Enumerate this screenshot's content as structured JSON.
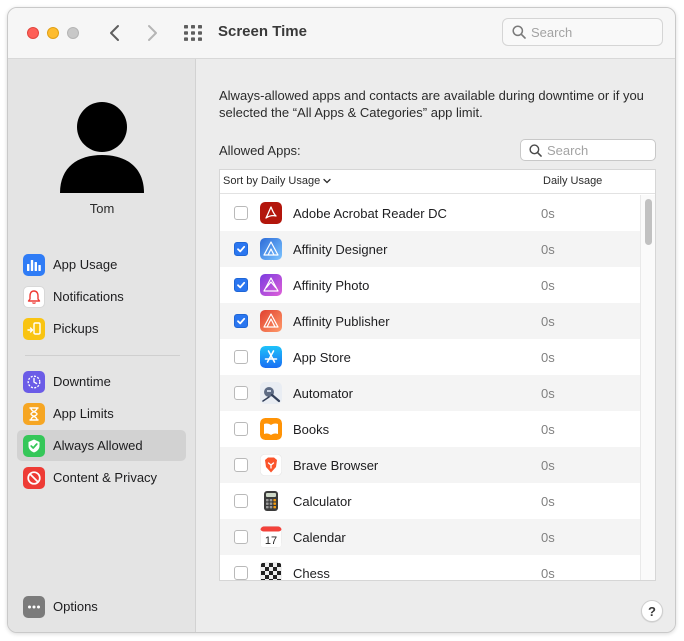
{
  "window": {
    "title": "Screen Time"
  },
  "toolbar": {
    "search_placeholder": "Search"
  },
  "user": {
    "name": "Tom"
  },
  "sidebar": {
    "group1": [
      {
        "name": "sidebar-item-app-usage",
        "label": "App Usage",
        "icon": "bar-chart-icon",
        "color": "#2f7cf6"
      },
      {
        "name": "sidebar-item-notifications",
        "label": "Notifications",
        "icon": "bell-icon",
        "color": "#ffffff"
      },
      {
        "name": "sidebar-item-pickups",
        "label": "Pickups",
        "icon": "phone-pickup-icon",
        "color": "#f9c412"
      }
    ],
    "group2": [
      {
        "name": "sidebar-item-downtime",
        "label": "Downtime",
        "icon": "moon-clock-icon",
        "color": "#6b5ce7"
      },
      {
        "name": "sidebar-item-app-limits",
        "label": "App Limits",
        "icon": "hourglass-icon",
        "color": "#f6a623"
      },
      {
        "name": "sidebar-item-always-allowed",
        "label": "Always Allowed",
        "icon": "checkmark-shield-icon",
        "color": "#35c759",
        "selected": true
      },
      {
        "name": "sidebar-item-content-privacy",
        "label": "Content & Privacy",
        "icon": "no-entry-icon",
        "color": "#ee3b35"
      }
    ],
    "options": {
      "label": "Options",
      "icon": "ellipsis-icon",
      "color": "#7b7b7b"
    }
  },
  "main": {
    "description": "Always-allowed apps and contacts are available during downtime or if you selected the “All Apps & Categories” app limit.",
    "allowed_label": "Allowed Apps:",
    "search_placeholder": "Search",
    "sort_label": "Sort by Daily Usage",
    "usage_header": "Daily Usage",
    "help_label": "?"
  },
  "apps": [
    {
      "name": "Adobe Acrobat Reader DC",
      "usage": "0s",
      "checked": false,
      "icon": "acrobat-icon"
    },
    {
      "name": "Affinity Designer",
      "usage": "0s",
      "checked": true,
      "icon": "affinity-designer-icon"
    },
    {
      "name": "Affinity Photo",
      "usage": "0s",
      "checked": true,
      "icon": "affinity-photo-icon"
    },
    {
      "name": "Affinity Publisher",
      "usage": "0s",
      "checked": true,
      "icon": "affinity-publisher-icon"
    },
    {
      "name": "App Store",
      "usage": "0s",
      "checked": false,
      "icon": "app-store-icon"
    },
    {
      "name": "Automator",
      "usage": "0s",
      "checked": false,
      "icon": "automator-icon"
    },
    {
      "name": "Books",
      "usage": "0s",
      "checked": false,
      "icon": "books-icon"
    },
    {
      "name": "Brave Browser",
      "usage": "0s",
      "checked": false,
      "icon": "brave-icon"
    },
    {
      "name": "Calculator",
      "usage": "0s",
      "checked": false,
      "icon": "calculator-icon"
    },
    {
      "name": "Calendar",
      "usage": "0s",
      "checked": false,
      "icon": "calendar-icon",
      "calendar_day": "17"
    },
    {
      "name": "Chess",
      "usage": "0s",
      "checked": false,
      "icon": "chess-icon"
    }
  ]
}
